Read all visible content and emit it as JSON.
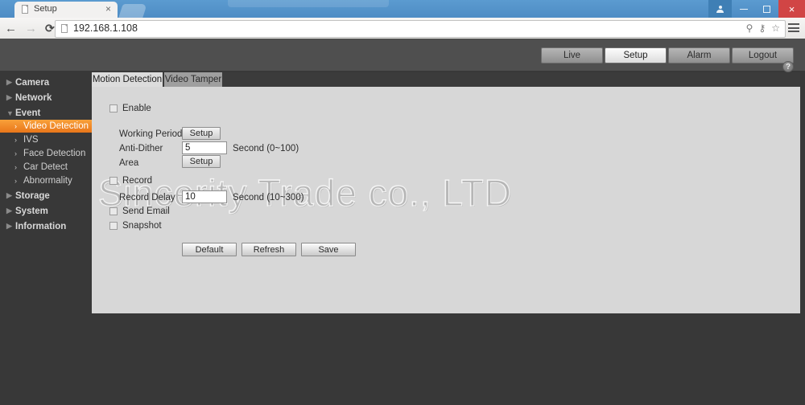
{
  "browser": {
    "tab_title": "Setup",
    "tab_close": "×",
    "url": "192.168.1.108",
    "back_icon": "←",
    "forward_icon": "→",
    "reload_icon": "⟳",
    "search_icon": "⚲",
    "key_icon": "⚷",
    "star_icon": "☆",
    "minimize_icon": "–",
    "maximize_icon": "□",
    "close_icon": "×"
  },
  "device": {
    "nav_buttons": [
      {
        "label": "Live",
        "active": false
      },
      {
        "label": "Setup",
        "active": true
      },
      {
        "label": "Alarm",
        "active": false
      },
      {
        "label": "Logout",
        "active": false
      }
    ],
    "sidebar": [
      {
        "label": "Camera",
        "level": "top",
        "arrow": "▶",
        "selected": false
      },
      {
        "label": "Network",
        "level": "top",
        "arrow": "▶",
        "selected": false
      },
      {
        "label": "Event",
        "level": "top",
        "arrow": "▼",
        "selected": false
      },
      {
        "label": "Video Detection",
        "level": "sub",
        "arrow": "›",
        "selected": true
      },
      {
        "label": "IVS",
        "level": "sub",
        "arrow": "›",
        "selected": false
      },
      {
        "label": "Face Detection",
        "level": "sub",
        "arrow": "›",
        "selected": false
      },
      {
        "label": "Car Detect",
        "level": "sub",
        "arrow": "›",
        "selected": false
      },
      {
        "label": "Abnormality",
        "level": "sub",
        "arrow": "›",
        "selected": false
      },
      {
        "label": "Storage",
        "level": "top",
        "arrow": "▶",
        "selected": false
      },
      {
        "label": "System",
        "level": "top",
        "arrow": "▶",
        "selected": false
      },
      {
        "label": "Information",
        "level": "top",
        "arrow": "▶",
        "selected": false
      }
    ],
    "tabs": [
      {
        "label": "Motion Detection",
        "active": true
      },
      {
        "label": "Video Tamper",
        "active": false
      }
    ],
    "help_icon": "?",
    "watermark": "Sincerity Trade co., LTD",
    "form": {
      "enable_label": "Enable",
      "enable_checked": false,
      "working_period_label": "Working Period",
      "working_period_button": "Setup",
      "anti_dither_label": "Anti-Dither",
      "anti_dither_value": "5",
      "anti_dither_unit": "Second (0~100)",
      "area_label": "Area",
      "area_button": "Setup",
      "record_label": "Record",
      "record_checked": false,
      "record_delay_label": "Record Delay",
      "record_delay_value": "10",
      "record_delay_unit": "Second (10~300)",
      "send_email_label": "Send Email",
      "send_email_checked": false,
      "snapshot_label": "Snapshot",
      "snapshot_checked": false
    },
    "actions": [
      {
        "label": "Default"
      },
      {
        "label": "Refresh"
      },
      {
        "label": "Save"
      }
    ],
    "colors": {
      "accent_orange": "#ee8a22",
      "page_dark": "#383838",
      "panel_gray": "#d7d7d7",
      "title_blue": "#5b9bd0",
      "close_red": "#d14545"
    }
  }
}
